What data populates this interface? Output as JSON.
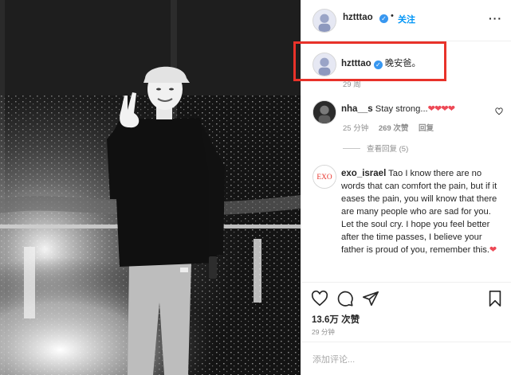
{
  "post": {
    "author": "hztttao",
    "follow_label": "关注",
    "caption": "晚安爸。",
    "caption_time_partial": "29 周",
    "likes": "13.6万 次赞",
    "time_ago": "29 分钟",
    "add_comment_placeholder": "添加评论..."
  },
  "comments": [
    {
      "user": "nha__s",
      "text": "Stay strong...",
      "hearts": "❤❤❤❤",
      "time": "25 分钟",
      "likes": "269 次赞",
      "reply_label": "回复",
      "view_replies": "查看回复 (5)"
    },
    {
      "user": "exo_israel",
      "text": "Tao I know there are no words that can comfort the pain, but if it eases the pain, you will know that there are many people who are sad for you. Let the soul cry. I hope you feel better after the time passes, I believe your father is proud of you, remember this.",
      "hearts": "❤"
    }
  ],
  "icons": {
    "verified": "verified-badge-icon",
    "like": "heart-icon",
    "comment": "comment-icon",
    "share": "paper-plane-icon",
    "save": "bookmark-icon"
  },
  "colors": {
    "link_blue": "#0095f6",
    "verified_blue": "#3897f0",
    "highlight_red": "#e8322a",
    "heart_red": "#ed4956",
    "muted_gray": "#8e8e8e"
  }
}
